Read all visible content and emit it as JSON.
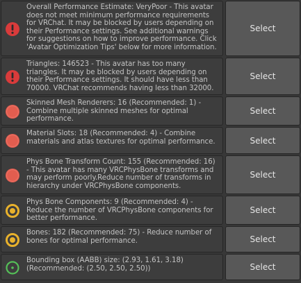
{
  "items": [
    {
      "severity": "error",
      "icon": "error-exclamation-icon",
      "text": "Overall Performance Estimate: VeryPoor - This avatar does not meet minimum performance requirements for VRChat. It may be blocked by users depending on their Performance settings. See additional warnings for suggestions on how to improve performance. Click 'Avatar Optimization Tips' below for more information.",
      "button": "Select"
    },
    {
      "severity": "error",
      "icon": "error-exclamation-icon",
      "text": "Triangles: 146523 - This avatar has too many triangles. It may be blocked by users depending on their Performance settings. It should have less than 70000. VRChat recommends having less than 32000.",
      "button": "Select"
    },
    {
      "severity": "very-poor",
      "icon": "red-circle-icon",
      "text": "Skinned Mesh Renderers: 16 (Recommended: 1) - Combine multiple skinned meshes for optimal performance.",
      "button": "Select"
    },
    {
      "severity": "very-poor",
      "icon": "red-circle-icon",
      "text": "Material Slots: 18 (Recommended: 4) - Combine materials and atlas textures for optimal performance.",
      "button": "Select"
    },
    {
      "severity": "very-poor",
      "icon": "red-circle-icon",
      "text": "Phys Bone Transform Count: 155 (Recommended: 16) - This avatar has many VRCPhysBone transforms and may perform poorly.Reduce number of transforms in hierarchy under VRCPhysBone components.",
      "button": "Select"
    },
    {
      "severity": "poor",
      "icon": "yellow-ring-icon",
      "text": "Phys Bone Components: 9 (Recommended: 4) - Reduce the number of VRCPhysBone components for better performance.",
      "button": "Select"
    },
    {
      "severity": "poor",
      "icon": "yellow-ring-icon",
      "text": "Bones: 182 (Recommended: 75) - Reduce number of bones for optimal performance.",
      "button": "Select"
    },
    {
      "severity": "good",
      "icon": "green-ring-icon",
      "text": "Bounding box (AABB) size: (2.93, 1.61, 3.18) (Recommended: (2.50, 2.50, 2.50))",
      "button": "Select"
    }
  ],
  "colors": {
    "error": "#d93b3b",
    "very-poor": "#e25d4f",
    "poor": "#e9b22c",
    "good": "#55c058"
  }
}
